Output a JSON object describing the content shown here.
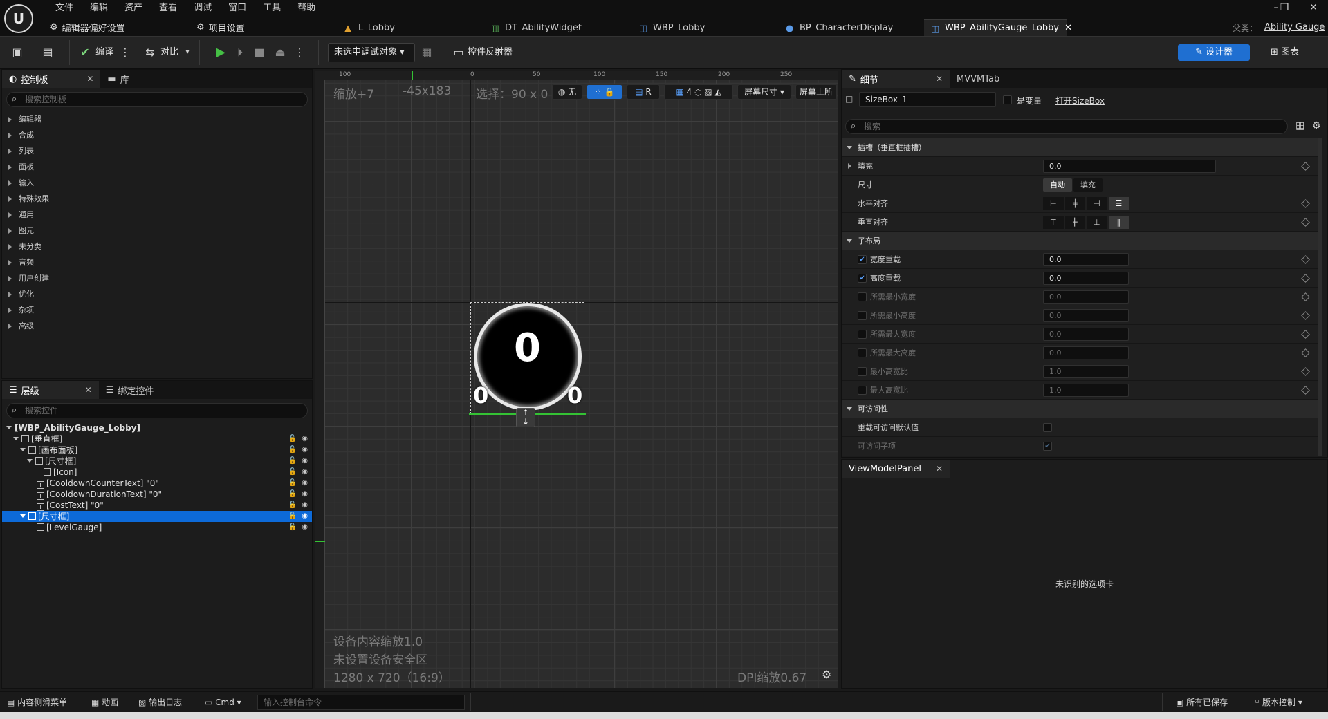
{
  "menu": [
    "文件",
    "编辑",
    "资产",
    "查看",
    "调试",
    "窗口",
    "工具",
    "帮助"
  ],
  "top_buttons": {
    "editor_prefs": "编辑器偏好设置",
    "project_settings": "项目设置"
  },
  "doc_tabs": [
    "L_Lobby",
    "DT_AbilityWidget",
    "WBP_Lobby",
    "BP_CharacterDisplay",
    "WBP_AbilityGauge_Lobby"
  ],
  "parent_class": {
    "label": "父类：",
    "value": "Ability Gauge"
  },
  "toolbar": {
    "compile": "编译",
    "diff": "对比",
    "debug_target": "未选中调试对象",
    "widget_reflector": "控件反射器",
    "designer": "设计器",
    "graph": "图表"
  },
  "palette": {
    "tab": "控制板",
    "library_tab": "库",
    "search_placeholder": "搜索控制板",
    "categories": [
      "编辑器",
      "合成",
      "列表",
      "面板",
      "输入",
      "特殊效果",
      "通用",
      "图元",
      "未分类",
      "音频",
      "用户创建",
      "优化",
      "杂项",
      "高级"
    ]
  },
  "hierarchy": {
    "tab": "层级",
    "bind_tab": "绑定控件",
    "search_placeholder": "搜索控件",
    "rows": [
      "[WBP_AbilityGauge_Lobby]",
      "[垂直框]",
      "[画布面板]",
      "[尺寸框]",
      "[Icon]",
      "[CooldownCounterText] \"0\"",
      "[CooldownDurationText] \"0\"",
      "[CostText] \"0\"",
      "[尺寸框]",
      "[LevelGauge]"
    ]
  },
  "viewport": {
    "zoom": "缩放+7",
    "coords": "-45x183",
    "selection": "选择：90 x 0",
    "none_label": "无",
    "r_label": "R",
    "grid_num": "4",
    "screen_size": "屏幕尺寸",
    "screen_top": "屏幕上所",
    "ruler_x": [
      "100",
      "0",
      "50",
      "100",
      "150",
      "200",
      "250"
    ],
    "device_scale": "设备内容缩放1.0",
    "safe_zone": "未设置设备安全区",
    "resolution": "1280 x 720（16:9）",
    "dpi": "DPI缩放0.67",
    "widget": {
      "center": "0",
      "left": "0",
      "right": "0"
    }
  },
  "details": {
    "tab": "细节",
    "mvvm_tab": "MVVMTab",
    "name": "SizeBox_1",
    "is_variable": "是变量",
    "open_link": "打开SizeBox",
    "search_placeholder": "搜索",
    "slot_section": "插槽（垂直框插槽）",
    "padding": "填充",
    "padding_value": "0.0",
    "size": "尺寸",
    "size_auto": "自动",
    "size_fill": "填充",
    "h_align": "水平对齐",
    "v_align": "垂直对齐",
    "child_layout": "子布局",
    "width_override": "宽度重载",
    "width_value": "0.0",
    "height_override": "高度重载",
    "height_value": "0.0",
    "min_desired_width": "所需最小宽度",
    "min_desired_height": "所需最小高度",
    "max_desired_width": "所需最大宽度",
    "max_desired_height": "所需最大高度",
    "min_aspect": "最小高宽比",
    "max_aspect": "最大高宽比",
    "zero": "0.0",
    "one": "1.0",
    "accessibility": "可访问性",
    "override_access": "重载可访问默认值",
    "access_children": "可访问子项"
  },
  "viewmodel": {
    "tab": "ViewModelPanel",
    "unrecognized": "未识别的选项卡"
  },
  "status": {
    "content_drawer": "内容侧滑菜单",
    "animation": "动画",
    "output_log": "输出日志",
    "cmd": "Cmd",
    "console_placeholder": "输入控制台命令",
    "all_saved": "所有已保存",
    "source_control": "版本控制"
  },
  "colors": {
    "accent": "#1f6fd1",
    "selection": "#0d6ad8",
    "green": "#34c234"
  }
}
